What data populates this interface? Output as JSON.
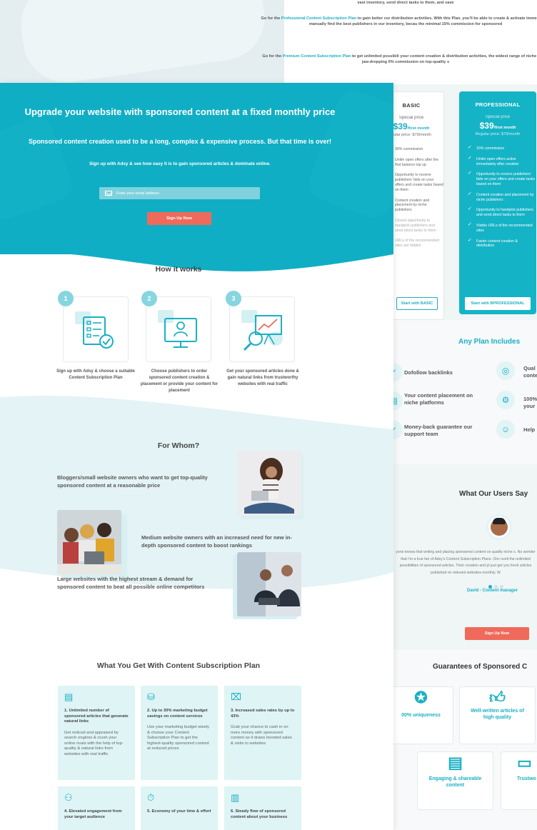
{
  "back": {
    "top_text": {
      "p1": "vast inventory, send direct tasks to them, and save",
      "p2_pre": "Go for the ",
      "p2_link": "Professional Content Subscription Plan",
      "p2_post": " to gain better cor distribution activities. With this Plan, you'll be able to create & activate immediately, manually find the best publishers in our inventory, becau the minimal 15% commission for sponsored",
      "p3_pre": "Go for the ",
      "p3_link": "Premium Content Subscription Plan",
      "p3_post": " to get unlimited possibili your content creation & distribution activities, the widest range of niche with a jaw-dropping 0% commission on top-quality s"
    },
    "plans": {
      "basic": {
        "name": "BASIC",
        "special": "Special price",
        "price": "$39",
        "per": "/first month",
        "regular": "gular price: $79/month",
        "features": [
          {
            "text": "30% commission",
            "dim": false
          },
          {
            "text": "Unlim open offers after the first balance top up",
            "dim": false
          },
          {
            "text": "Opportunity to receive publishers' bids on your offers and create tasks based on them",
            "dim": false
          },
          {
            "text": "Content creation and placement by niche publishers",
            "dim": false
          },
          {
            "text": "Closed opportunity to handpick publishers and send direct tasks to them",
            "dim": true
          },
          {
            "text": "URLs of the recommended sites are hidden",
            "dim": true
          }
        ],
        "button": "Start with BASIC"
      },
      "pro": {
        "name": "PROFESSIONAL",
        "special": "Special price",
        "price": "$39",
        "per": "/first month",
        "regular": "Regular price: $79/month",
        "features": [
          "15% commission",
          "Unlim open offers active immediately after creation",
          "Opportunity to receive publishers' bids on your offers and create tasks based on them",
          "Content creation and placement by niche publishers",
          "Opportunity to handpick publishers and send direct tasks to them",
          "Visible URLs of the recommended sites",
          "Faster content creation & distribution"
        ],
        "button": "Start with BPROFESSIONAL"
      }
    },
    "any_plan": {
      "title": "Any Plan Includes",
      "items": [
        "Dofollow backlinks",
        "Your content placement on niche platforms",
        "Money-back guarantee our support team",
        "Qual conte",
        "100% your",
        "Help"
      ]
    },
    "users": {
      "title": "What Our Users Say",
      "quote": "yone knows that writing and placing sponsored content on quality niche s. No wonder that I'm a true fan of Adsy's Content Subscription Plans. Onc nvell the unlimited possibilities of sponsored articles. Their creation and pl just get you fresh articles published on relevant websites monthly. W",
      "name": "David - Content manager",
      "signup": "Sign Up Now"
    },
    "guarantees": {
      "title": "Guarantees of Sponsored C",
      "items": [
        "00% uniqueness",
        "Well-written articles of high quality",
        "Engaging & shareable content",
        "Trustwo"
      ]
    }
  },
  "hero": {
    "title": "Upgrade your website with sponsored content at a fixed monthly price",
    "subtitle": "Sponsored content creation used to be a long, complex & expensive process. But that time is over!",
    "tagline": "Sign up with Adsy & see how easy it is to gain sponsored articles & dominate online.",
    "email_placeholder": "Enter your email address",
    "signup": "Sign Up Now"
  },
  "how": {
    "title": "How it works",
    "steps": [
      {
        "num": "1",
        "text": "Sign up with Adsy & choose a suitable Content Subscription Plan"
      },
      {
        "num": "2",
        "text": "Choose publishers to order sponsored content creation & placement or provide your content for placement"
      },
      {
        "num": "3",
        "text": "Get your sponsored articles done & gain natural links from trustworthy websites with real traffic"
      }
    ]
  },
  "whom": {
    "title": "For Whom?",
    "items": [
      "Bloggers/small website owners who want to get top-quality sponsored content at a reasonable price",
      "Medium website owners with an increased need for new in-depth sponsored content to boost rankings",
      "Large websites with the highest stream & demand for sponsored content to beat all possible online competitors"
    ]
  },
  "wyg": {
    "title": "What You Get With Content Subscription Plan",
    "cards": [
      {
        "title": "1. Unlimited number of sponsored articles that generate natural links",
        "desc": "Get noticed and appraised by search engines & crush your online rivals with the help of top-quality & natural links from websites with real traffic",
        "icon": "document-list-icon"
      },
      {
        "title": "2. Up to 30% marketing budget savings on content services",
        "desc": "Use your marketing budget wisely & choose your Content Subscription Plan to get the highest-quality sponsored content at reduced prices",
        "icon": "coins-icon"
      },
      {
        "title": "3. Increased sales rates by up to 43%",
        "desc": "Grab your chance to cash in on more money with sponsored content as it draws boosted sales & visits to websites",
        "icon": "chart-board-icon"
      },
      {
        "title": "4. Elevated engagement from your target audience",
        "desc": "",
        "icon": "people-icon"
      },
      {
        "title": "5. Economy of your time & effort",
        "desc": "",
        "icon": "stopwatch-icon"
      },
      {
        "title": "6. Steady flow of sponsored content about your business",
        "desc": "",
        "icon": "documents-icon"
      }
    ]
  },
  "colors": {
    "accent": "#1ab0c4",
    "hero": "#10aec4",
    "cta": "#ef6a5a"
  }
}
